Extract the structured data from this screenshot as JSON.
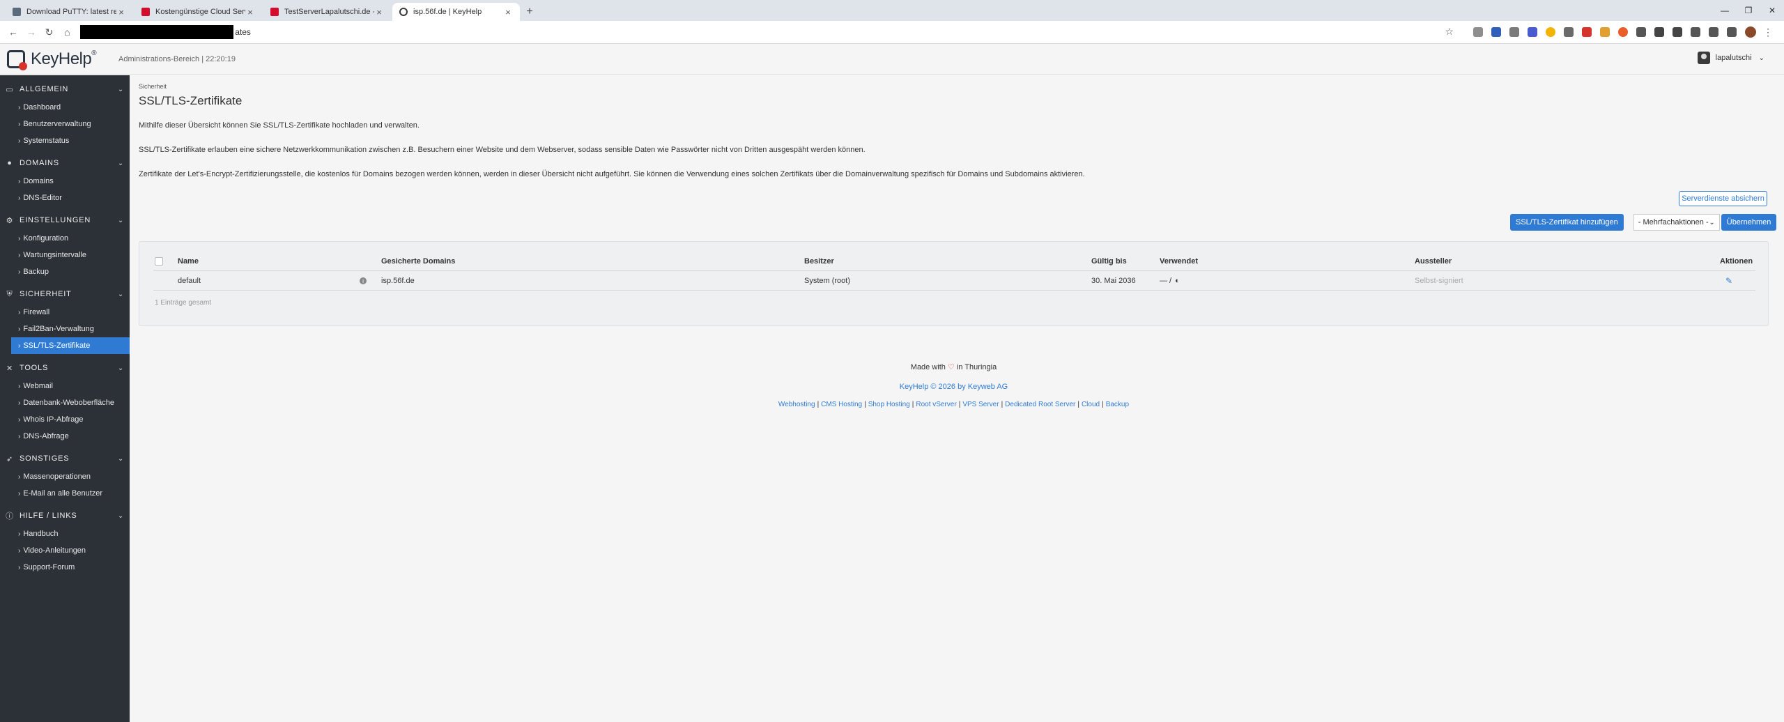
{
  "browser": {
    "tabs": [
      {
        "title": "Download PuTTY: latest release",
        "favicon": "putty-icon",
        "active": false
      },
      {
        "title": "Kostengünstige Cloud Server f",
        "favicon": "hetzner-icon",
        "active": false
      },
      {
        "title": "TestServerLapalutschi.de - Hetz",
        "favicon": "hetzner-icon",
        "active": false
      },
      {
        "title": "isp.56f.de | KeyHelp",
        "favicon": "keyhelp-icon",
        "active": true
      }
    ],
    "url_visible": "ates"
  },
  "header": {
    "brand": "KeyHelp",
    "brand_sup": "®",
    "admin_info": "Administrations-Bereich | 22:20:19",
    "username": "lapalutschi"
  },
  "sidebar": {
    "sections": [
      {
        "label": "ALLGEMEIN",
        "icon": "monitor-icon",
        "items": [
          "Dashboard",
          "Benutzerverwaltung",
          "Systemstatus"
        ]
      },
      {
        "label": "DOMAINS",
        "icon": "globe-icon",
        "items": [
          "Domains",
          "DNS-Editor"
        ]
      },
      {
        "label": "EINSTELLUNGEN",
        "icon": "gear-icon",
        "items": [
          "Konfiguration",
          "Wartungsintervalle",
          "Backup"
        ]
      },
      {
        "label": "SICHERHEIT",
        "icon": "shield-icon",
        "items": [
          "Firewall",
          "Fail2Ban-Verwaltung",
          "SSL/TLS-Zertifikate"
        ]
      },
      {
        "label": "TOOLS",
        "icon": "tools-icon",
        "items": [
          "Webmail",
          "Datenbank-Weboberfläche",
          "Whois IP-Abfrage",
          "DNS-Abfrage"
        ]
      },
      {
        "label": "SONSTIGES",
        "icon": "rocket-icon",
        "items": [
          "Massenoperationen",
          "E-Mail an alle Benutzer"
        ]
      },
      {
        "label": "HILFE / LINKS",
        "icon": "info-icon",
        "items": [
          "Handbuch",
          "Video-Anleitungen",
          "Support-Forum"
        ]
      }
    ],
    "active_item": "SSL/TLS-Zertifikate"
  },
  "main": {
    "breadcrumb": "Sicherheit",
    "title": "SSL/TLS-Zertifikate",
    "paragraphs": [
      "Mithilfe dieser Übersicht können Sie SSL/TLS-Zertifikate hochladen und verwalten.",
      "SSL/TLS-Zertifikate erlauben eine sichere Netzwerkkommunikation zwischen z.B. Besuchern einer Website und dem Webserver, sodass sensible Daten wie Passwörter nicht von Dritten ausgespäht werden können.",
      "Zertifikate der Let's-Encrypt-Zertifizierungsstelle, die kostenlos für Domains bezogen werden können, werden in dieser Übersicht nicht aufgeführt. Sie können die Verwendung eines solchen Zertifikats über die Domainverwaltung spezifisch für Domains und Subdomains aktivieren."
    ],
    "btn_secure_services": "Serverdienste absichern",
    "btn_add_cert": "SSL/TLS-Zertifikat hinzufügen",
    "bulk_select": "- Mehrfachaktionen -",
    "btn_apply": "Übernehmen",
    "table": {
      "headers": {
        "name": "Name",
        "domains": "Gesicherte Domains",
        "owner": "Besitzer",
        "valid": "Gültig bis",
        "used": "Verwendet",
        "issuer": "Aussteller",
        "actions": "Aktionen"
      },
      "rows": [
        {
          "name": "default",
          "domains": "isp.56f.de",
          "owner": "System (root)",
          "valid": "30. Mai 2036",
          "used": "— /",
          "issuer": "Selbst-signiert"
        }
      ],
      "total": "1 Einträge gesamt"
    }
  },
  "footer": {
    "made_prefix": "Made with",
    "made_suffix": "in Thuringia",
    "copyright": "KeyHelp © 2026 by Keyweb AG",
    "links": [
      "Webhosting",
      "CMS Hosting",
      "Shop Hosting",
      "Root vServer",
      "VPS Server",
      "Dedicated Root Server",
      "Cloud",
      "Backup"
    ]
  },
  "colors": {
    "accent": "#2f7bd4",
    "sidebar_bg": "#2b3137",
    "logo_red": "#d6332c"
  }
}
